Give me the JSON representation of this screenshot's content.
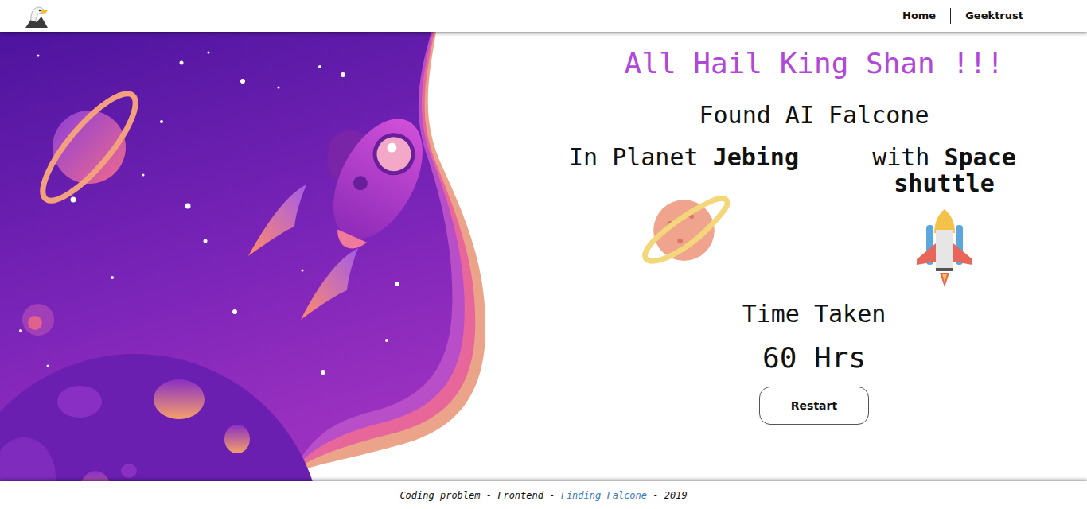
{
  "header": {
    "nav": [
      {
        "label": "Home"
      },
      {
        "label": "Geektrust"
      }
    ]
  },
  "result": {
    "headline": "All Hail King Shan !!!",
    "subtitle": "Found AI Falcone",
    "planet_prefix": "In Planet",
    "planet": "Jebing",
    "vehicle_prefix": "with",
    "vehicle": "Space shuttle",
    "time_label": "Time Taken",
    "time": "60 Hrs",
    "button": "Restart"
  },
  "footer": {
    "prefix": "Coding problem - Frontend - ",
    "link": "Finding Falcone",
    "suffix": " - 2019"
  }
}
